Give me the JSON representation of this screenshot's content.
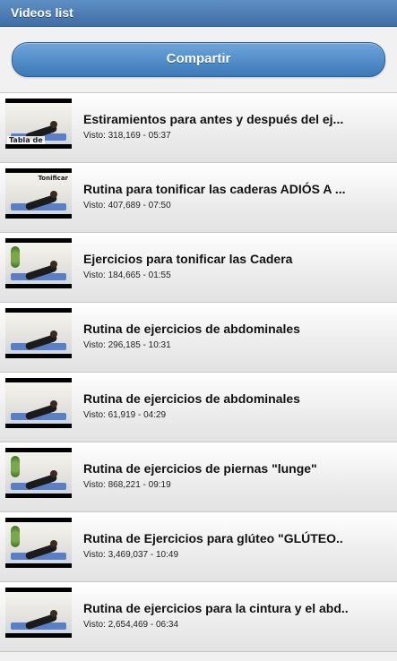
{
  "header": {
    "title": "Videos list"
  },
  "share": {
    "label": "Compartir"
  },
  "videos": [
    {
      "title": "Estiramientos para antes y después del ej...",
      "views": "318,169",
      "duration": "05:37",
      "thumb_caption": "Tabla de",
      "thumb_caption_top": "",
      "thumb_icon": "video-thumbnail-icon"
    },
    {
      "title": "Rutina para tonificar las caderas ADIÓS A ...",
      "views": "407,689",
      "duration": "07:50",
      "thumb_caption": "",
      "thumb_caption_top": "Tonificar",
      "thumb_icon": "video-thumbnail-icon"
    },
    {
      "title": "Ejercicios para tonificar las Cadera",
      "views": "184,665",
      "duration": "01:55",
      "thumb_caption": "",
      "thumb_caption_top": "",
      "thumb_icon": "video-thumbnail-icon"
    },
    {
      "title": "Rutina de ejercicios de abdominales",
      "views": "296,185",
      "duration": "10:31",
      "thumb_caption": "",
      "thumb_caption_top": "",
      "thumb_icon": "video-thumbnail-icon"
    },
    {
      "title": "Rutina de ejercicios de abdominales",
      "views": "61,919",
      "duration": "04:29",
      "thumb_caption": "",
      "thumb_caption_top": "",
      "thumb_icon": "video-thumbnail-icon"
    },
    {
      "title": "Rutina de ejercicios de piernas \"lunge\"",
      "views": "868,221",
      "duration": "09:19",
      "thumb_caption": "",
      "thumb_caption_top": "",
      "thumb_icon": "video-thumbnail-icon"
    },
    {
      "title": "Rutina de Ejercicios para glúteo \"GLÚTEO..",
      "views": "3,469,037",
      "duration": "10:49",
      "thumb_caption": "",
      "thumb_caption_top": "",
      "thumb_icon": "video-thumbnail-icon"
    },
    {
      "title": "Rutina de ejercicios para la cintura y el abd..",
      "views": "2,654,469",
      "duration": "06:34",
      "thumb_caption": "",
      "thumb_caption_top": "",
      "thumb_icon": "video-thumbnail-icon"
    }
  ],
  "labels": {
    "views_prefix": "Visto: ",
    "separator": " - "
  },
  "colors": {
    "header_bar": "#4f7fb5",
    "share_button": "#4f8ac7"
  }
}
